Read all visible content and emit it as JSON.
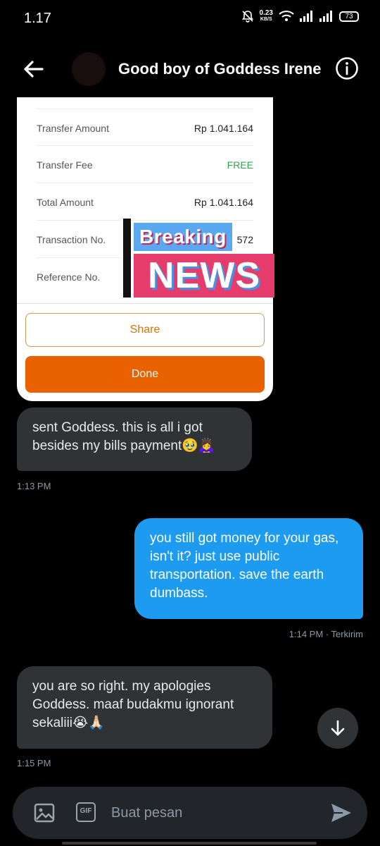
{
  "status_bar": {
    "time": "1.17",
    "net_speed_value": "0.23",
    "net_speed_unit": "KB/S",
    "battery": "73",
    "icons": [
      "mute-icon",
      "wifi-icon",
      "signal-icon",
      "signal-icon",
      "battery-icon"
    ]
  },
  "header": {
    "title": "Good boy of Goddess Irene",
    "back_icon": "arrow-left-icon",
    "info_icon": "info-icon"
  },
  "transfer_image": {
    "rows": [
      {
        "label": "Transfer Amount",
        "value": "Rp 1.041.164"
      },
      {
        "label": "Transfer Fee",
        "value": "FREE"
      },
      {
        "label": "Total Amount",
        "value": "Rp 1.041.164"
      },
      {
        "label": "Transaction No.",
        "value": "572"
      },
      {
        "label": "Reference No.",
        "value": ""
      }
    ],
    "share_label": "Share",
    "done_label": "Done",
    "sticker": {
      "line1": "Breaking",
      "line2": "NEWS"
    },
    "colors": {
      "free": "#2ea44f",
      "done_button": "#ea6200",
      "share_text": "#d4730b"
    }
  },
  "messages": [
    {
      "direction": "in",
      "text": "sent Goddess. this is all i got besides my bills payment🥹🙇‍♀️",
      "timestamp": "1:13 PM"
    },
    {
      "direction": "out",
      "text": "you still got money for your gas, isn't it? just use public transportation. save the earth dumbass.",
      "timestamp": "1:14 PM · Terkirim"
    },
    {
      "direction": "in",
      "text": "you are so right. my apologies Goddess. maaf budakmu ignorant sekaliii😭🙏🏻",
      "timestamp": "1:15 PM"
    }
  ],
  "composer": {
    "placeholder": "Buat pesan",
    "image_icon": "image-icon",
    "gif_label": "GIF",
    "send_icon": "send-icon"
  },
  "colors": {
    "outgoing_bubble": "#1d9bf0",
    "incoming_bubble": "#2f3336",
    "background": "#000000"
  }
}
